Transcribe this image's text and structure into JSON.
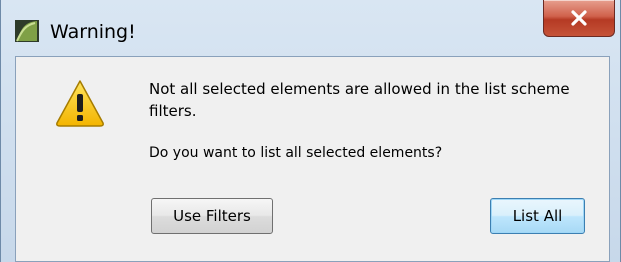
{
  "window": {
    "title": "Warning!",
    "app_icon": "archicad-icon",
    "close_icon": "close-icon"
  },
  "dialog": {
    "icon": "warning-icon",
    "message": "Not all selected elements are allowed in the list scheme filters.",
    "question": "Do you want to list all selected elements?"
  },
  "buttons": {
    "use_filters": "Use Filters",
    "list_all": "List All"
  }
}
